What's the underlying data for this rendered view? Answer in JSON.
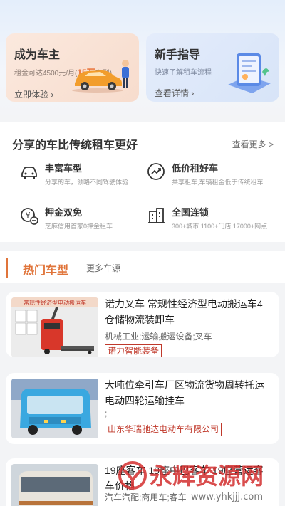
{
  "promos": {
    "owner": {
      "title": "成为车主",
      "sub_prefix": "租金可达4500元/月(",
      "sub_highlight": "15万",
      "sub_suffix": "车型)",
      "link": "立即体验",
      "link_icon": "chevron-right"
    },
    "guide": {
      "title": "新手指导",
      "sub": "快速了解租车流程",
      "link": "查看详情",
      "link_icon": "chevron-right"
    }
  },
  "share": {
    "title": "分享的车比传统租车更好",
    "more": "查看更多 >",
    "features": [
      {
        "title": "丰富车型",
        "desc": "分享的车，领略不同驾驶体验",
        "icon": "car-icon"
      },
      {
        "title": "低价租好车",
        "desc": "共享租车,车辆租金低于传统租车",
        "icon": "price-trend-icon"
      },
      {
        "title": "押金双免",
        "desc": "芝麻信用首家0押金租车",
        "icon": "deposit-free-icon"
      },
      {
        "title": "全国连锁",
        "desc": "300+城市 1100+门店 17000+网点",
        "icon": "building-icon"
      }
    ]
  },
  "hot": {
    "title": "热门车型",
    "more": "更多车源",
    "cars": [
      {
        "name": "诺力叉车 常规性经济型电动搬运车4仓储物流装卸车",
        "tags": "机械工业;运输搬运设备;叉车",
        "company": "诺力智能装备",
        "image_label": "常规性经济型电动搬运车"
      },
      {
        "name": "大吨位牵引车厂区物流货物周转托运电动四轮运输挂车",
        "tags": ";",
        "company": "山东华瑞驰达电动车有限公司"
      },
      {
        "name": "19座客车 19座中巴客车 19座营运客车价格",
        "tags": "汽车汽配;商用车;客车"
      }
    ]
  },
  "watermark": {
    "text": "永辉资源网",
    "url": "www.yhkjjj.com"
  },
  "colors": {
    "accent": "#e0743a",
    "company_border": "#c0392b",
    "owner_bg": "#f7dccd",
    "guide_bg": "#d7e4f8"
  }
}
